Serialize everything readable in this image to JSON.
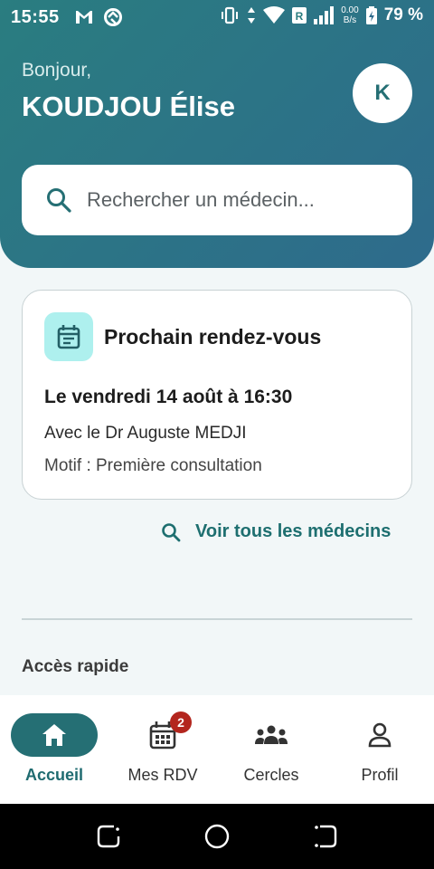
{
  "status_bar": {
    "time": "15:55",
    "speed_value": "0.00",
    "speed_unit": "B/s",
    "battery": "79 %",
    "icons": [
      "gmail-icon",
      "vpn-icon",
      "vibrate-icon",
      "data-arrows-icon",
      "wifi-icon",
      "roaming-icon",
      "signal-icon",
      "battery-icon"
    ]
  },
  "header": {
    "greeting": "Bonjour,",
    "user_name": "KOUDJOU Élise",
    "avatar_initial": "K",
    "gradient_start": "#2a7d80",
    "gradient_end": "#2e6b8c"
  },
  "search": {
    "placeholder": "Rechercher un médecin..."
  },
  "appointment": {
    "title": "Prochain rendez-vous",
    "date": "Le vendredi 14 août à 16:30",
    "doctor": "Avec le Dr Auguste MEDJI",
    "reason": "Motif : Première consultation",
    "icon": "calendar-icon"
  },
  "links": {
    "see_all_doctors": "Voir tous les médecins"
  },
  "quick_access": {
    "title": "Accès rapide"
  },
  "bottom_nav": {
    "items": [
      {
        "label": "Accueil",
        "icon": "home-icon",
        "active": true
      },
      {
        "label": "Mes RDV",
        "icon": "calendar-icon",
        "badge": "2"
      },
      {
        "label": "Cercles",
        "icon": "groups-icon"
      },
      {
        "label": "Profil",
        "icon": "person-icon"
      }
    ]
  },
  "colors": {
    "accent": "#256f74",
    "badge": "#b3261e",
    "icon_bg": "#aef0ee"
  }
}
